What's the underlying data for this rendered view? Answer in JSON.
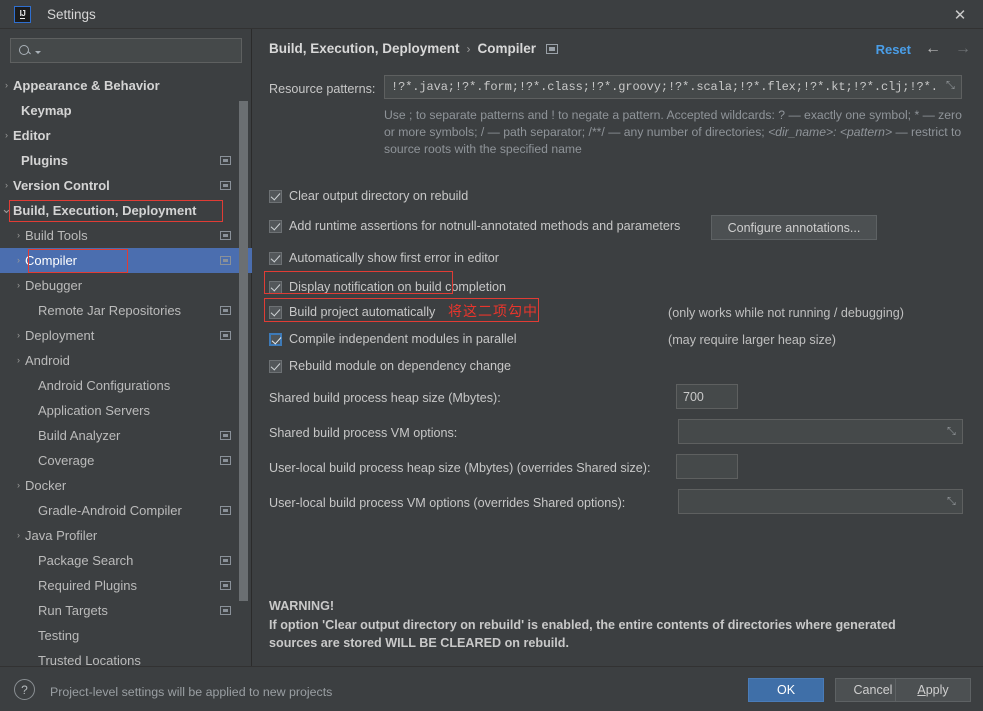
{
  "window": {
    "title": "Settings",
    "logo_text": "IJ",
    "close_label": "✕"
  },
  "sidebar": {
    "search": {
      "placeholder": ""
    },
    "items": [
      {
        "label": "Appearance & Behavior",
        "arrow": "›",
        "bold": true,
        "badge": false,
        "indent": 8,
        "selected": false
      },
      {
        "label": "Keymap",
        "arrow": "",
        "bold": true,
        "badge": false,
        "indent": 21,
        "selected": false
      },
      {
        "label": "Editor",
        "arrow": "›",
        "bold": true,
        "badge": false,
        "indent": 8,
        "selected": false
      },
      {
        "label": "Plugins",
        "arrow": "",
        "bold": true,
        "badge": true,
        "indent": 21,
        "selected": false
      },
      {
        "label": "Version Control",
        "arrow": "›",
        "bold": true,
        "badge": true,
        "indent": 8,
        "selected": false
      },
      {
        "label": "Build, Execution, Deployment",
        "arrow": "⌄",
        "bold": true,
        "badge": false,
        "indent": 8,
        "selected": false
      },
      {
        "label": "Build Tools",
        "arrow": "›",
        "bold": false,
        "badge": true,
        "indent": 25,
        "selected": false
      },
      {
        "label": "Compiler",
        "arrow": "›",
        "bold": false,
        "badge": true,
        "indent": 25,
        "selected": true
      },
      {
        "label": "Debugger",
        "arrow": "›",
        "bold": false,
        "badge": false,
        "indent": 25,
        "selected": false
      },
      {
        "label": "Remote Jar Repositories",
        "arrow": "",
        "bold": false,
        "badge": true,
        "indent": 38,
        "selected": false
      },
      {
        "label": "Deployment",
        "arrow": "›",
        "bold": false,
        "badge": true,
        "indent": 25,
        "selected": false
      },
      {
        "label": "Android",
        "arrow": "›",
        "bold": false,
        "badge": false,
        "indent": 25,
        "selected": false
      },
      {
        "label": "Android Configurations",
        "arrow": "",
        "bold": false,
        "badge": false,
        "indent": 38,
        "selected": false
      },
      {
        "label": "Application Servers",
        "arrow": "",
        "bold": false,
        "badge": false,
        "indent": 38,
        "selected": false
      },
      {
        "label": "Build Analyzer",
        "arrow": "",
        "bold": false,
        "badge": true,
        "indent": 38,
        "selected": false
      },
      {
        "label": "Coverage",
        "arrow": "",
        "bold": false,
        "badge": true,
        "indent": 38,
        "selected": false
      },
      {
        "label": "Docker",
        "arrow": "›",
        "bold": false,
        "badge": false,
        "indent": 25,
        "selected": false
      },
      {
        "label": "Gradle-Android Compiler",
        "arrow": "",
        "bold": false,
        "badge": true,
        "indent": 38,
        "selected": false
      },
      {
        "label": "Java Profiler",
        "arrow": "›",
        "bold": false,
        "badge": false,
        "indent": 25,
        "selected": false
      },
      {
        "label": "Package Search",
        "arrow": "",
        "bold": false,
        "badge": true,
        "indent": 38,
        "selected": false
      },
      {
        "label": "Required Plugins",
        "arrow": "",
        "bold": false,
        "badge": true,
        "indent": 38,
        "selected": false
      },
      {
        "label": "Run Targets",
        "arrow": "",
        "bold": false,
        "badge": true,
        "indent": 38,
        "selected": false
      },
      {
        "label": "Testing",
        "arrow": "",
        "bold": false,
        "badge": false,
        "indent": 38,
        "selected": false
      },
      {
        "label": "Trusted Locations",
        "arrow": "",
        "bold": false,
        "badge": false,
        "indent": 38,
        "selected": false
      }
    ]
  },
  "header": {
    "breadcrumb_root": "Build, Execution, Deployment",
    "breadcrumb_sep": "›",
    "breadcrumb_leaf": "Compiler",
    "reset_label": "Reset",
    "back_arrow": "←",
    "forward_arrow": "→"
  },
  "main": {
    "resource_patterns_label": "Resource patterns:",
    "resource_patterns_value": "!?*.java;!?*.form;!?*.class;!?*.groovy;!?*.scala;!?*.flex;!?*.kt;!?*.clj;!?*.",
    "hint_line1": "Use ; to separate patterns and ! to negate a pattern. Accepted wildcards: ? — exactly one symbol; * — zero",
    "hint_line2_a": "or more symbols; / — path separator; /**/ — any number of directories;  ",
    "hint_line2_i": "<dir_name>: <pattern>",
    "hint_line2_b": " — restrict to",
    "hint_line3": "source roots with the specified name",
    "checkboxes": [
      {
        "label": "Clear output directory on rebuild",
        "checked": true,
        "focused": false,
        "note": ""
      },
      {
        "label": "Add runtime assertions for notnull-annotated methods and parameters",
        "checked": true,
        "focused": false,
        "note": ""
      },
      {
        "label": "Automatically show first error in editor",
        "checked": true,
        "focused": false,
        "note": ""
      },
      {
        "label": "Display notification on build completion",
        "checked": true,
        "focused": false,
        "note": ""
      },
      {
        "label": "Build project automatically",
        "checked": true,
        "focused": false,
        "note": "(only works while not running / debugging)"
      },
      {
        "label": "Compile independent modules in parallel",
        "checked": true,
        "focused": true,
        "note": "(may require larger heap size)"
      },
      {
        "label": "Rebuild module on dependency change",
        "checked": true,
        "focused": false,
        "note": ""
      }
    ],
    "configure_annotations_label": "Configure annotations...",
    "annotation_cn": "将这二项勾中",
    "fields": [
      {
        "label": "Shared build process heap size (Mbytes):",
        "value": "700",
        "expandable": false
      },
      {
        "label": "Shared build process VM options:",
        "value": "",
        "expandable": true
      },
      {
        "label": "User-local build process heap size (Mbytes) (overrides Shared size):",
        "value": "",
        "expandable": false
      },
      {
        "label": "User-local build process VM options (overrides Shared options):",
        "value": "",
        "expandable": true
      }
    ],
    "warning_title": "WARNING!",
    "warning_line1": "If option 'Clear output directory on rebuild' is enabled, the entire contents of directories where generated",
    "warning_line2": "sources are stored WILL BE CLEARED on rebuild."
  },
  "footer": {
    "help_glyph": "?",
    "note": "Project-level settings will be applied to new projects",
    "ok_label": "OK",
    "cancel_label": "Cancel",
    "apply_label": "Apply"
  },
  "colors": {
    "background": "#3c3f41",
    "selection": "#4b6eaf",
    "accent_link": "#4a9ee8",
    "annotation_red": "#e8352c",
    "primary_button": "#3f6fa8"
  }
}
